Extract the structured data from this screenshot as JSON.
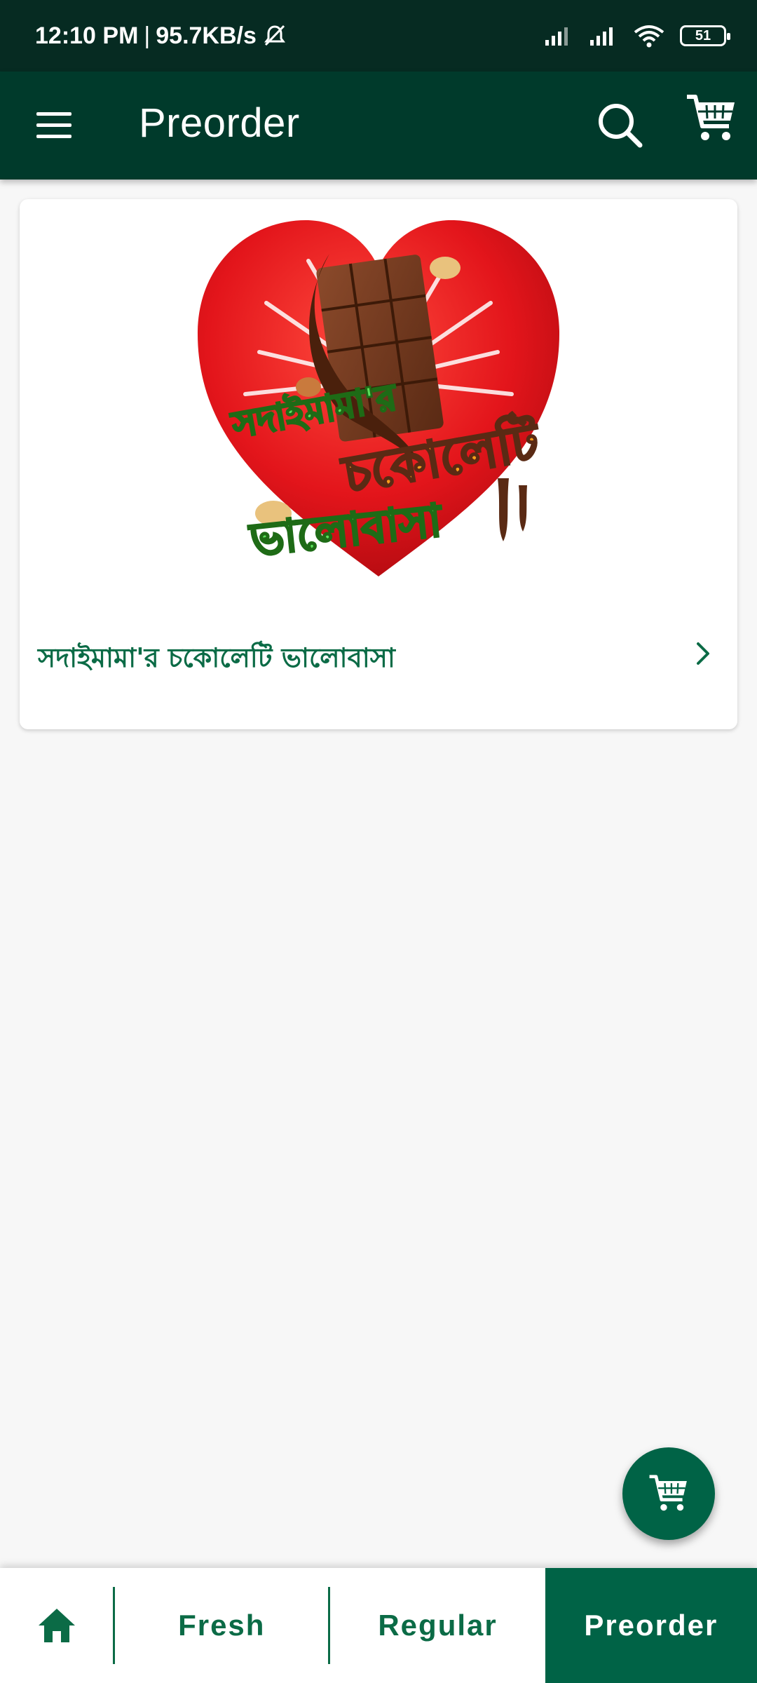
{
  "status_bar": {
    "time": "12:10 PM",
    "separator": "|",
    "speed": "95.7KB/s",
    "battery": "51"
  },
  "app_bar": {
    "title": "Preorder"
  },
  "card": {
    "title": "সদাইমামা'র চকোলেটি ভালোবাসা",
    "image_text": [
      "সদাইমামা'র",
      "চকোলেটি",
      "ভালোবাসা"
    ]
  },
  "bottom_nav": {
    "fresh": "Fresh",
    "regular": "Regular",
    "preorder": "Preorder",
    "active": "Preorder"
  },
  "colors": {
    "status_bg": "#062b22",
    "appbar_bg": "#003a2b",
    "primary": "#006346",
    "accent_text": "#0b6b46",
    "heart": "#e3151b"
  },
  "icons": {
    "menu": "menu-icon",
    "search": "search-icon",
    "cart": "cart-icon",
    "home": "home-icon",
    "chevron": "chevron-right-icon",
    "fab": "add-to-cart-icon"
  }
}
